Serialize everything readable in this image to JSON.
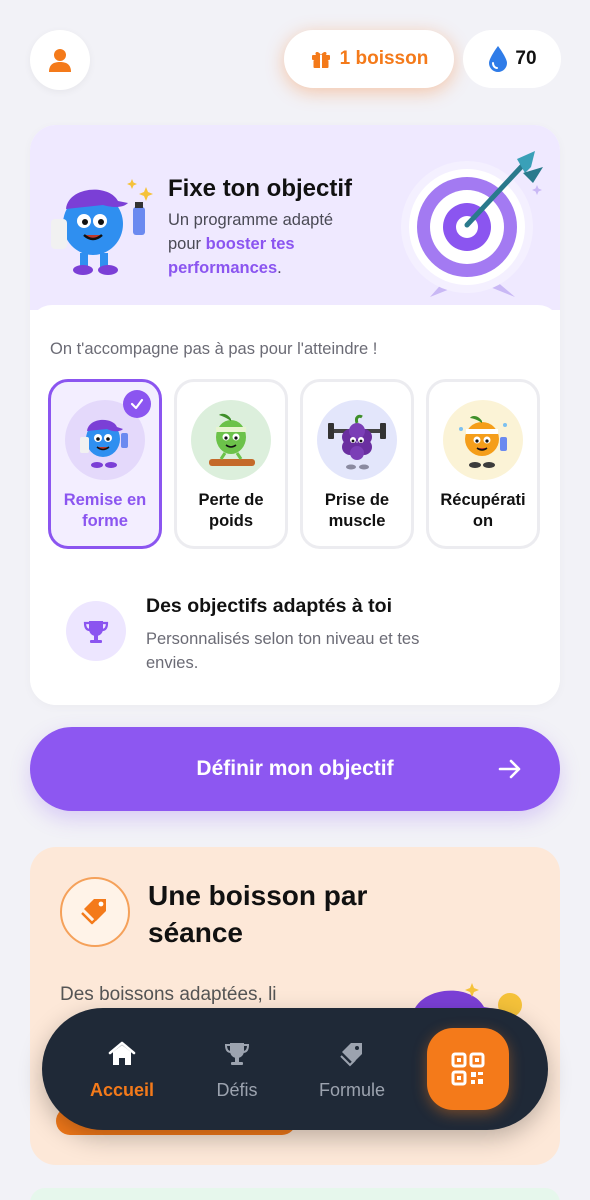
{
  "header": {
    "drinks_label": "1 boisson",
    "drops_count": "70"
  },
  "goal_card": {
    "title": "Fixe ton objectif",
    "subtitle_prefix": "Un programme adapté pour ",
    "subtitle_highlight": "booster tes performances",
    "subtitle_suffix": ".",
    "accompany_text": "On t'accompagne pas à pas pour l'atteindre !",
    "options": [
      {
        "label": "Remise en forme",
        "selected": true
      },
      {
        "label": "Perte de poids",
        "selected": false
      },
      {
        "label": "Prise de muscle",
        "selected": false
      },
      {
        "label": "Récupérati on",
        "selected": false
      }
    ],
    "info_title": "Des objectifs adaptés à toi",
    "info_subtitle": "Personnalisés selon ton niveau et tes envies."
  },
  "cta": {
    "label": "Définir mon objectif"
  },
  "drink_card": {
    "title": "Une boisson par séance",
    "subtitle": "Des boissons adaptées, li"
  },
  "nav": {
    "items": [
      {
        "label": "Accueil",
        "icon": "home-icon",
        "active": true
      },
      {
        "label": "Défis",
        "icon": "trophy-icon",
        "active": false
      },
      {
        "label": "Formule",
        "icon": "tag-icon",
        "active": false
      }
    ],
    "qr_icon": "qr-code-icon"
  },
  "colors": {
    "accent_purple": "#8d57f1",
    "accent_orange": "#f47a1a",
    "nav_bg": "#1f2937",
    "hero_bg": "#efe9ff",
    "drink_bg": "#fde8d8"
  }
}
